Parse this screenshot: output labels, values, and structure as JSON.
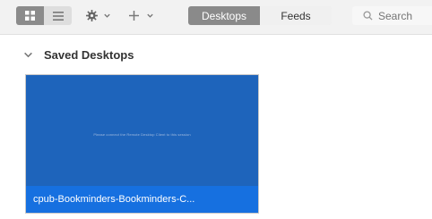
{
  "toolbar": {
    "view_buttons": [
      {
        "icon": "grid-icon",
        "active": true
      },
      {
        "icon": "list-icon",
        "active": false
      }
    ],
    "gear_icon": "gear-icon",
    "add_icon": "plus-icon",
    "tabs": [
      {
        "label": "Desktops",
        "active": true
      },
      {
        "label": "Feeds",
        "active": false
      }
    ],
    "search": {
      "placeholder": "Search",
      "value": ""
    }
  },
  "section": {
    "title": "Saved Desktops",
    "expanded": true
  },
  "desktops": [
    {
      "name": "cpub-Bookminders-Bookminders-C...",
      "preview_text": "Please connect the Remote Desktop Client to this session",
      "color": "#1e64bb"
    }
  ]
}
